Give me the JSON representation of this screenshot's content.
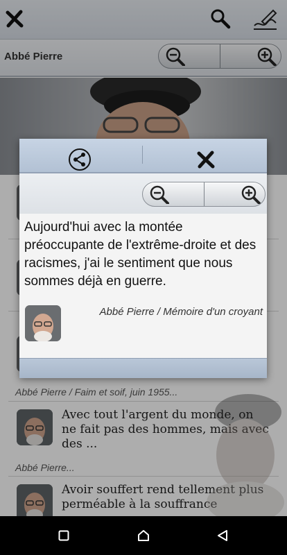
{
  "topbar": {
    "close_icon": "close-x-icon",
    "search_icon": "search-icon",
    "edit_icon": "pen-signature-icon"
  },
  "header": {
    "title": "Abbé Pierre",
    "zoom_out_icon": "zoom-out-icon",
    "zoom_in_icon": "zoom-in-icon"
  },
  "list": {
    "items": [
      {
        "caption": "Abbé Pierre / Faim et soif, juin 1955..."
      },
      {
        "text": "Avec tout l'argent du monde, on ne fait pas des hommes, mais avec des  ...",
        "caption": "Abbé Pierre..."
      },
      {
        "text": "Avoir souffert rend tellement plus perméable à la souffrance"
      }
    ]
  },
  "popup": {
    "share_icon": "share-icon",
    "close_icon": "close-x-icon",
    "quote": "Aujourd'hui avec la montée préoccupante de l'extrême-droite et des racismes, j'ai le sentiment que nous sommes déjà en guerre.",
    "author": "Abbé Pierre / Mémoire d'un croyant"
  },
  "navbar": {
    "recents_icon": "recents-square-icon",
    "home_icon": "home-icon",
    "back_icon": "back-triangle-icon"
  }
}
